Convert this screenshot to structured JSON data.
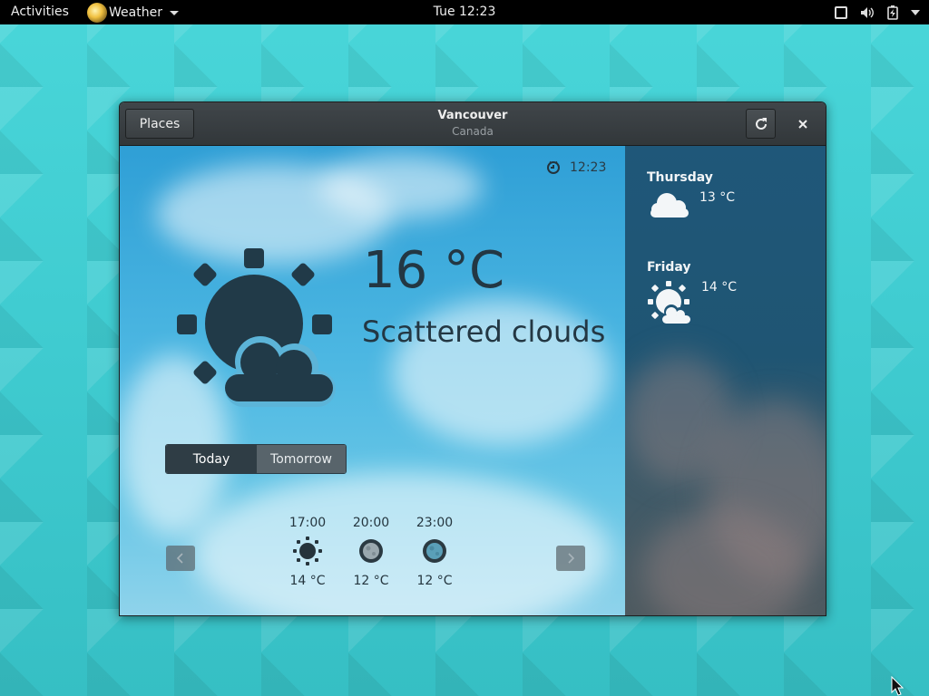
{
  "topbar": {
    "activities": "Activities",
    "app_menu": "Weather",
    "clock": "Tue 12:23",
    "icons": [
      "screen-icon",
      "volume-icon",
      "battery-icon",
      "system-menu-icon"
    ]
  },
  "window": {
    "title": "Vancouver",
    "subtitle": "Canada",
    "places_label": "Places"
  },
  "current": {
    "time": "12:23",
    "temperature": "16 °C",
    "summary": "Scattered clouds",
    "icon": "few-clouds-icon"
  },
  "tabs": {
    "today": "Today",
    "tomorrow": "Tomorrow",
    "selected": "Today"
  },
  "hourly": [
    {
      "time": "17:00",
      "temp": "14 °C",
      "icon": "sun-icon"
    },
    {
      "time": "20:00",
      "temp": "12 °C",
      "icon": "moon-icon"
    },
    {
      "time": "23:00",
      "temp": "12 °C",
      "icon": "moon-icon"
    }
  ],
  "forecast": [
    {
      "day": "Thursday",
      "temp": "13 °C",
      "icon": "cloud-icon"
    },
    {
      "day": "Friday",
      "temp": "14 °C",
      "icon": "few-clouds-icon"
    }
  ],
  "colors": {
    "accent_dark": "#233743",
    "sky_top": "#2f9fd6",
    "sidebar": "#1f5779",
    "panel": "#000000"
  }
}
